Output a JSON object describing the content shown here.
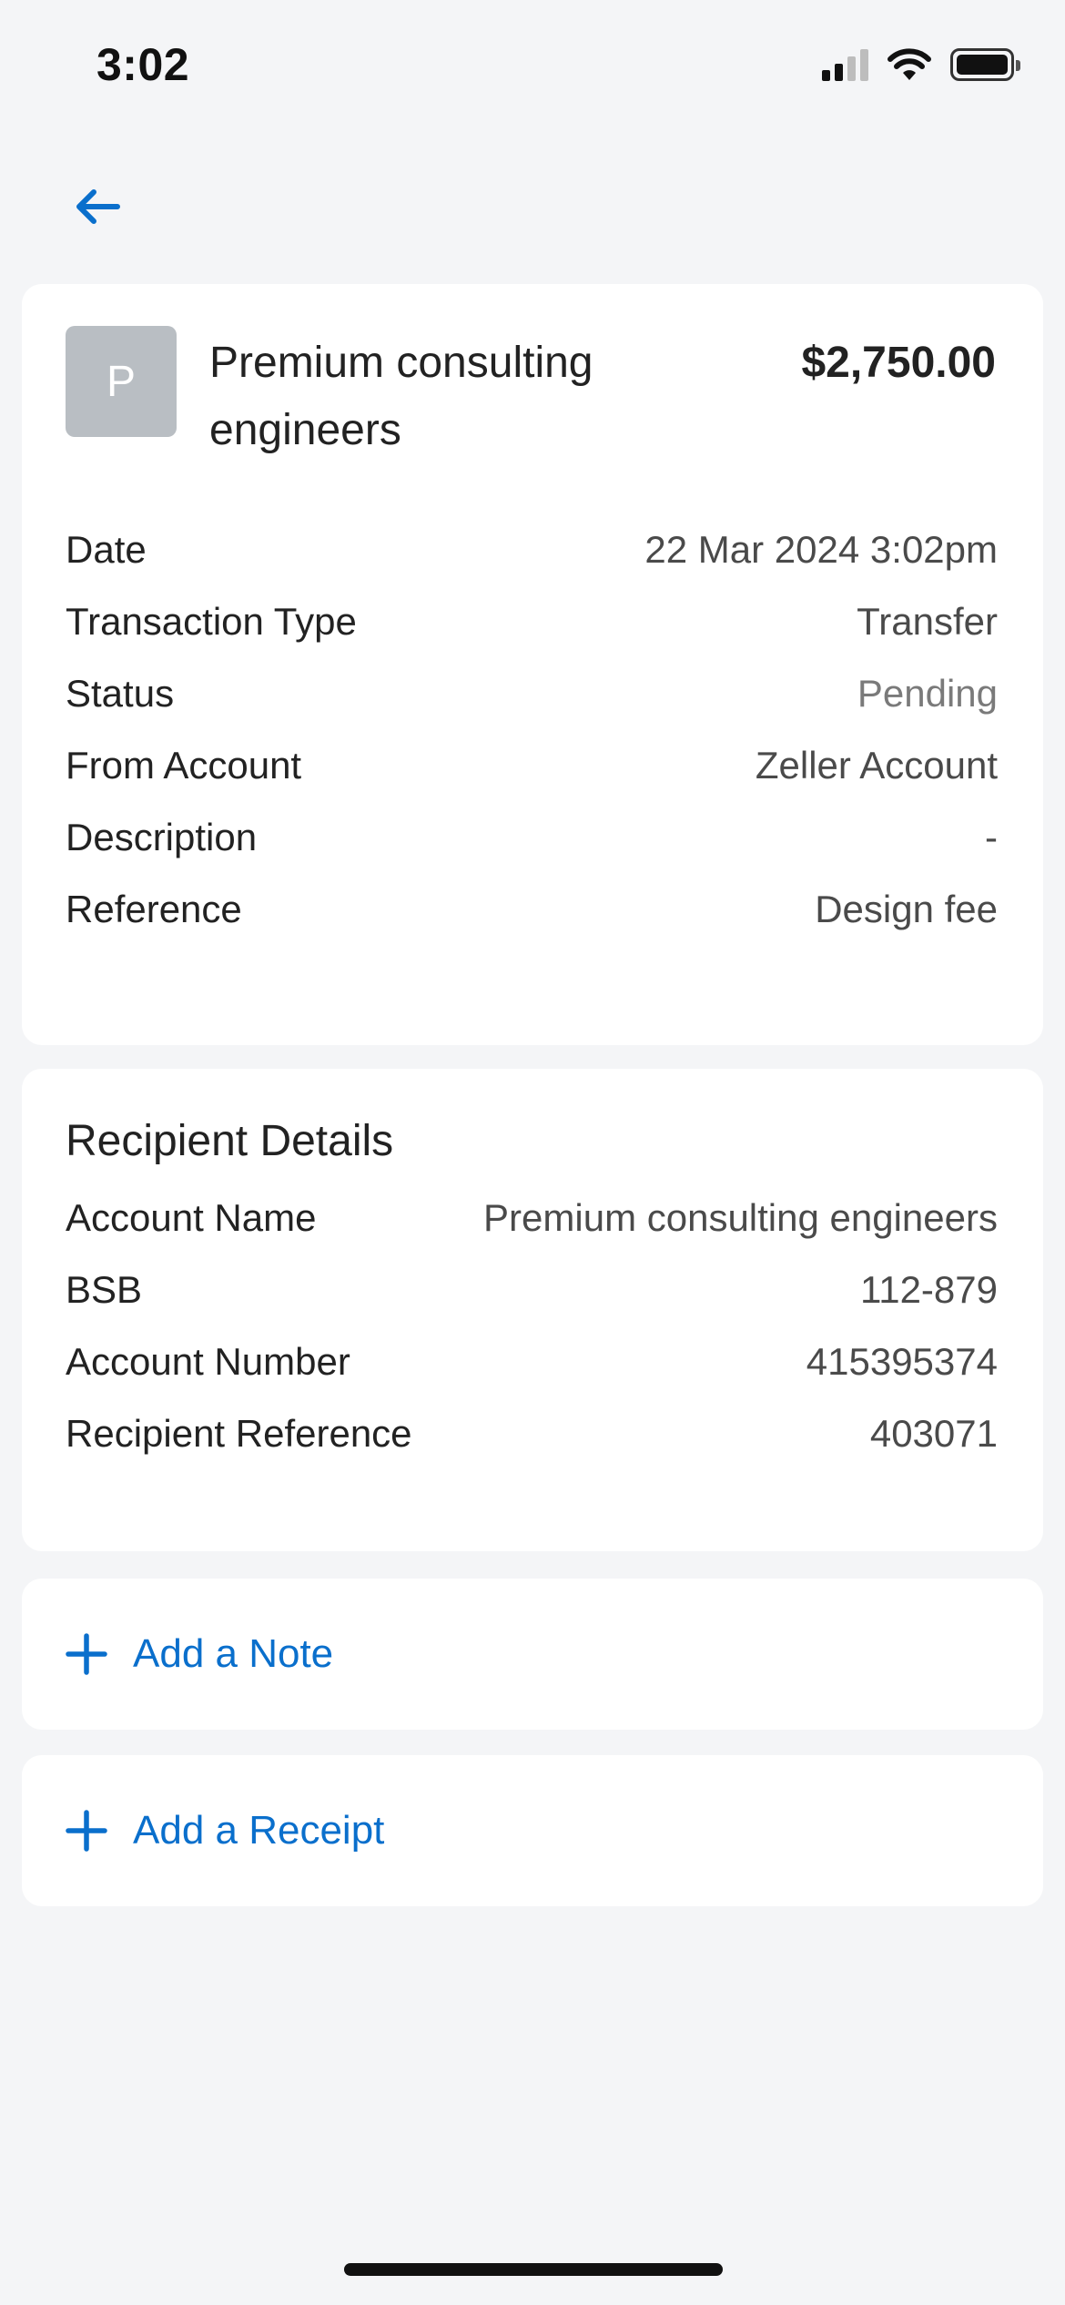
{
  "status_bar": {
    "time": "3:02",
    "icons": [
      "cellular-signal-icon",
      "wifi-icon",
      "battery-icon"
    ]
  },
  "nav": {
    "back_icon": "arrow-left-icon"
  },
  "transaction": {
    "avatar_initial": "P",
    "merchant": "Premium consulting engineers",
    "amount": "$2,750.00",
    "details": [
      {
        "label": "Date",
        "value": "22 Mar 2024 3:02pm"
      },
      {
        "label": "Transaction Type",
        "value": "Transfer"
      },
      {
        "label": "Status",
        "value": "Pending"
      },
      {
        "label": "From Account",
        "value": "Zeller Account"
      },
      {
        "label": "Description",
        "value": "-"
      },
      {
        "label": "Reference",
        "value": "Design fee"
      }
    ]
  },
  "recipient": {
    "title": "Recipient Details",
    "details": [
      {
        "label": "Account Name",
        "value": "Premium consulting engineers"
      },
      {
        "label": "BSB",
        "value": "112-879"
      },
      {
        "label": "Account Number",
        "value": "415395374"
      },
      {
        "label": "Recipient Reference",
        "value": "403071"
      }
    ]
  },
  "actions": {
    "add_note": "Add a Note",
    "add_receipt": "Add a Receipt"
  },
  "colors": {
    "accent": "#0a6fcc",
    "background": "#f4f5f7",
    "card": "#ffffff",
    "avatar": "#b9bec3"
  }
}
